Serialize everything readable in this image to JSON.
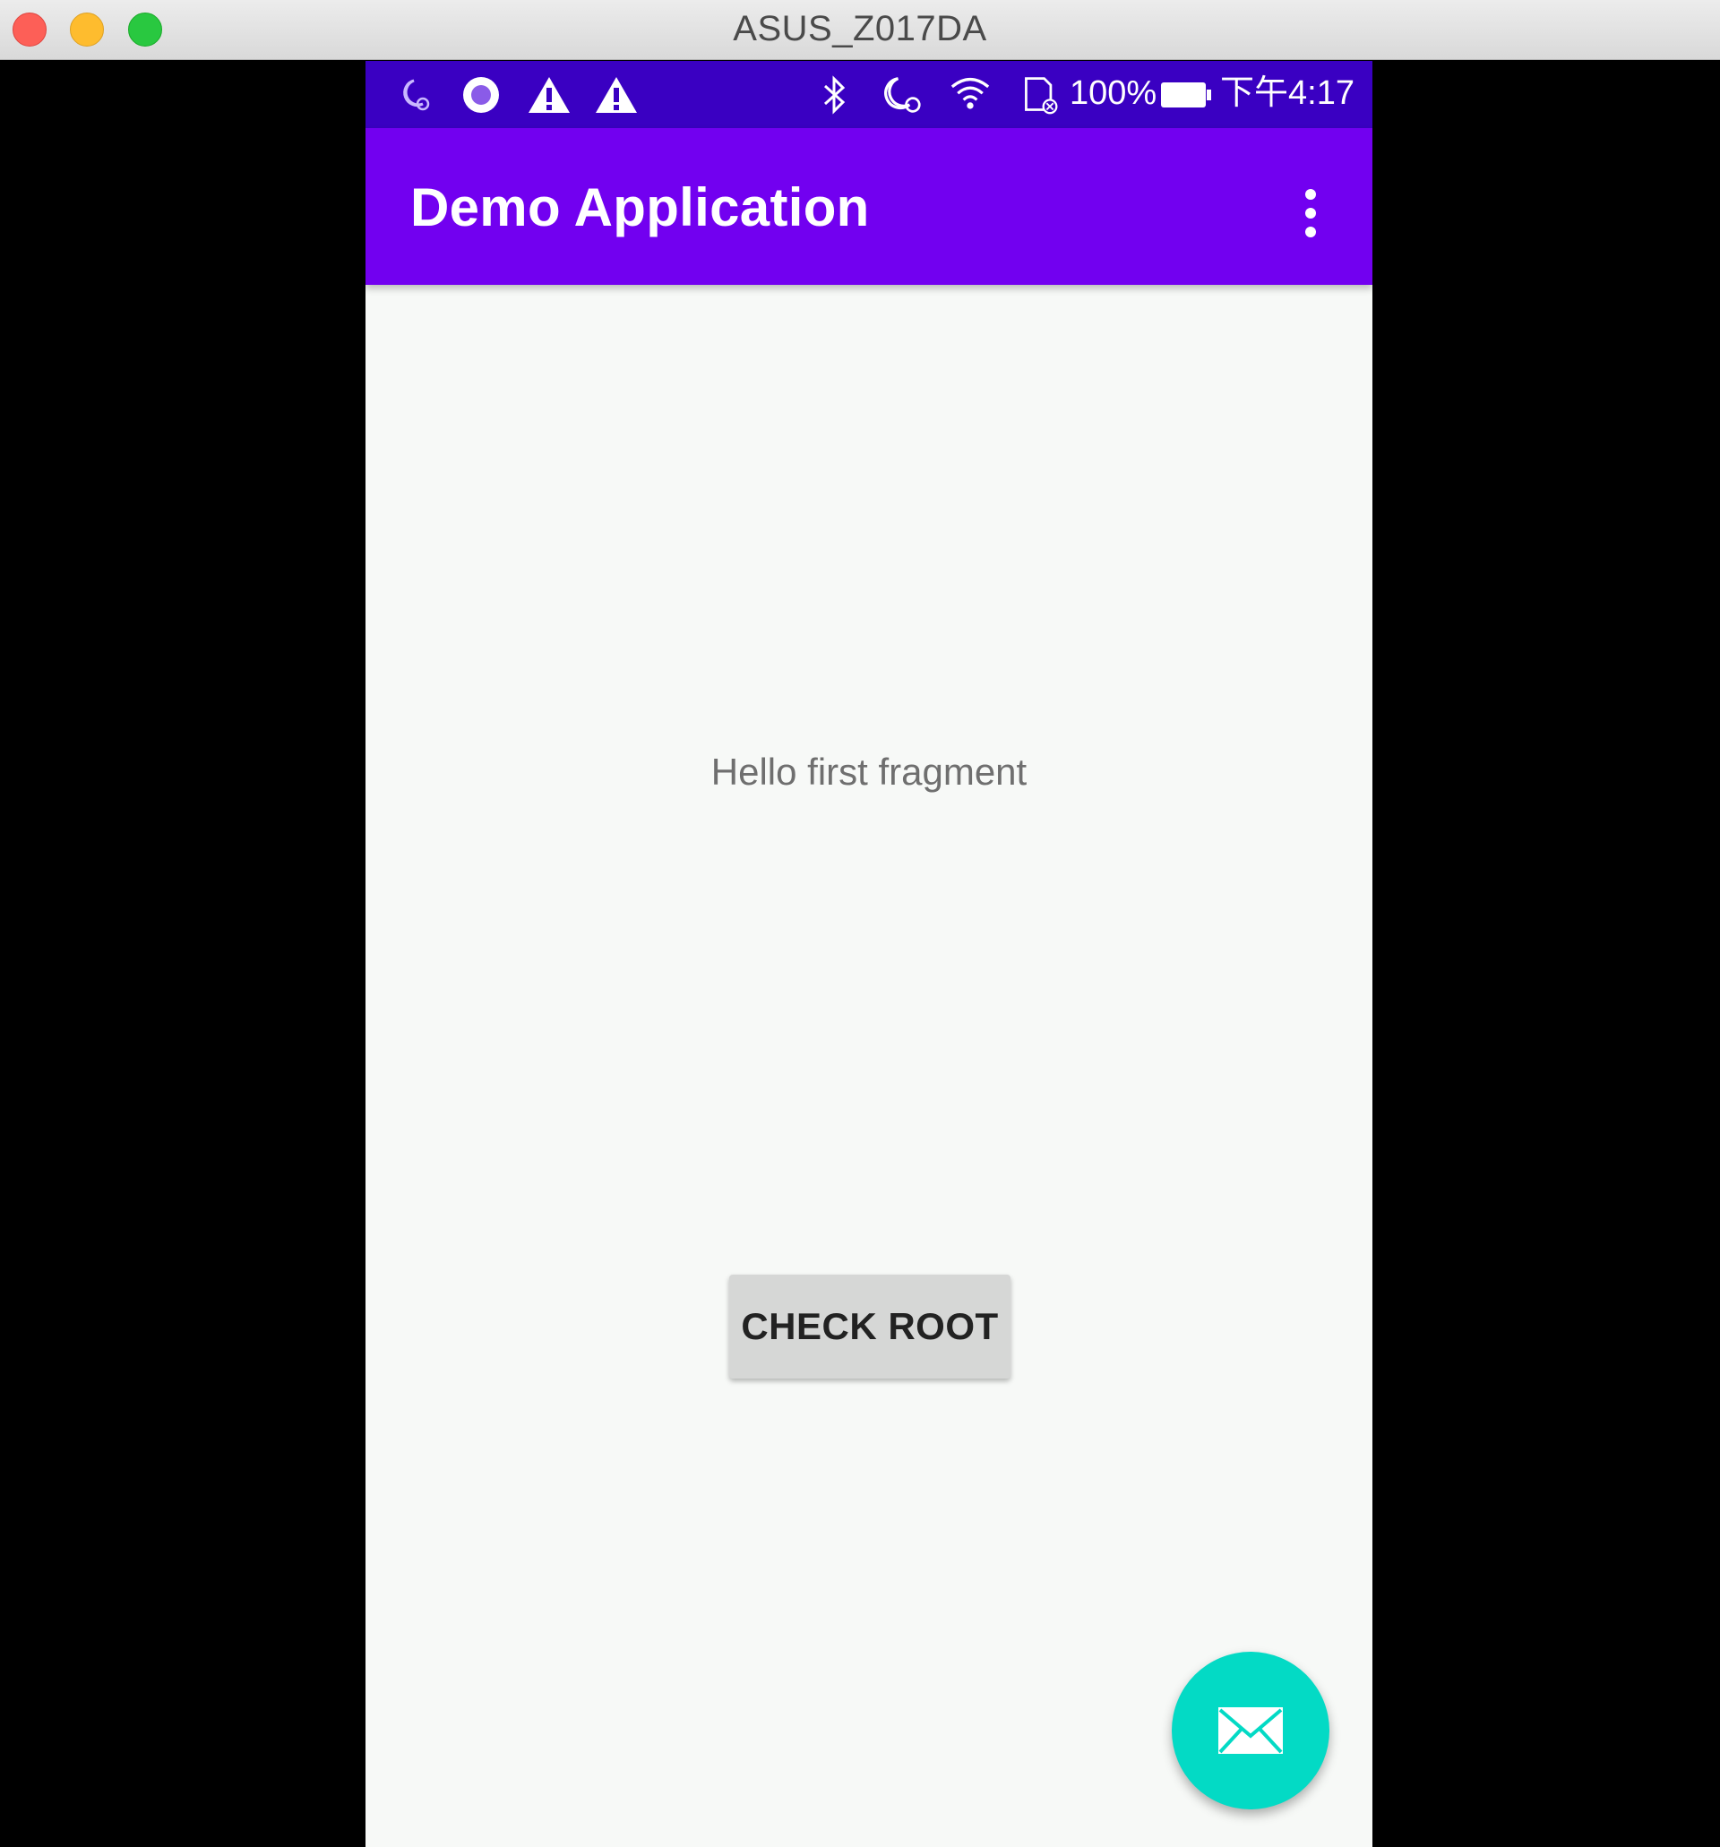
{
  "window": {
    "title": "ASUS_Z017DA"
  },
  "status_bar": {
    "battery_percent": "100%",
    "time": "下午4:17",
    "left_icons": [
      "moon-alarm-icon",
      "record-icon",
      "warning-icon",
      "warning-icon"
    ],
    "right_icons": [
      "bluetooth-icon",
      "do-not-disturb-icon",
      "wifi-icon",
      "sd-card-icon",
      "battery-icon"
    ]
  },
  "app_bar": {
    "title": "Demo Application"
  },
  "content": {
    "message": "Hello first fragment",
    "check_root_label": "CHECK ROOT"
  },
  "fab": {
    "icon": "mail-icon"
  },
  "colors": {
    "status_bar": "#3a00c2",
    "app_bar": "#7200f0",
    "fab": "#03dac5",
    "background": "#f7f9f7"
  }
}
